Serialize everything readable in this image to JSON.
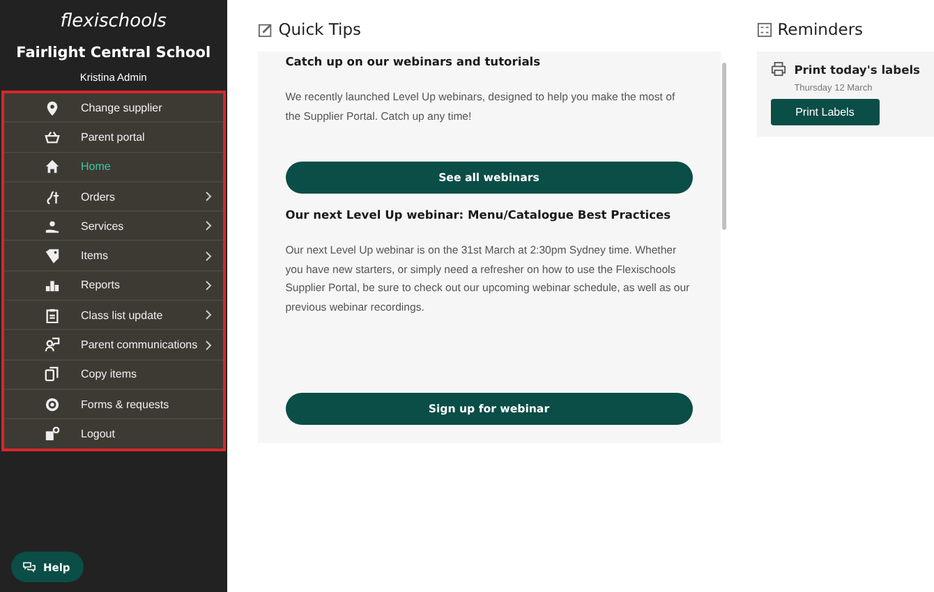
{
  "sidebar": {
    "logo": "flexischools",
    "school": "Fairlight Central School",
    "user": "Kristina Admin",
    "menu": [
      {
        "label": "Change supplier",
        "selected": false,
        "has_submenu": false
      },
      {
        "label": "Parent portal",
        "selected": false,
        "has_submenu": false
      },
      {
        "label": "Home",
        "selected": true,
        "has_submenu": false
      },
      {
        "label": "Orders",
        "selected": false,
        "has_submenu": true
      },
      {
        "label": "Services",
        "selected": false,
        "has_submenu": true
      },
      {
        "label": "Items",
        "selected": false,
        "has_submenu": true
      },
      {
        "label": "Reports",
        "selected": false,
        "has_submenu": true
      },
      {
        "label": "Class list update",
        "selected": false,
        "has_submenu": true
      },
      {
        "label": "Parent communications",
        "selected": false,
        "has_submenu": true
      },
      {
        "label": "Copy items",
        "selected": false,
        "has_submenu": false
      },
      {
        "label": "Forms & requests",
        "selected": false,
        "has_submenu": false
      },
      {
        "label": "Logout",
        "selected": false,
        "has_submenu": false
      }
    ],
    "help_button": "Help"
  },
  "quick_tips": {
    "title": "Quick Tips",
    "tips": [
      {
        "heading": "Catch up on our webinars and tutorials",
        "body": "We recently launched Level Up webinars, designed to help you make the most of the Supplier Portal. Catch up any time!",
        "button": "See all webinars"
      },
      {
        "heading": "Our next Level Up webinar: Menu/Catalogue Best Practices",
        "body": "Our next Level Up webinar is on the 31st March at 2:30pm Sydney time. Whether you have new starters, or simply need a refresher on how to use the Flexischools Supplier Portal, be sure to check out our upcoming webinar schedule, as well as our previous webinar recordings.",
        "button": "Sign up for webinar"
      }
    ]
  },
  "reminders": {
    "title": "Reminders",
    "items": [
      {
        "title": "Print today's labels",
        "date": "Thursday 12 March",
        "button": "Print Labels"
      }
    ]
  }
}
